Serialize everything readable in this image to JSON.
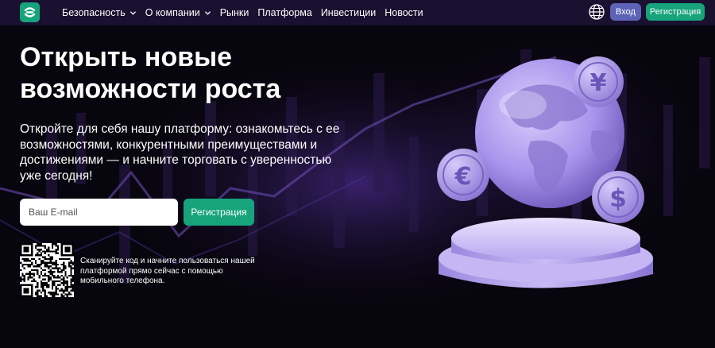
{
  "nav": {
    "items": [
      {
        "label": "Безопасность",
        "has_dropdown": true
      },
      {
        "label": "О компании",
        "has_dropdown": true
      },
      {
        "label": "Рынки",
        "has_dropdown": false
      },
      {
        "label": "Платформа",
        "has_dropdown": false
      },
      {
        "label": "Инвестиции",
        "has_dropdown": false
      },
      {
        "label": "Новости",
        "has_dropdown": false
      }
    ],
    "login_label": "Вход",
    "register_label": "Регистрация",
    "globe_icon": "globe-icon"
  },
  "hero": {
    "title": "Открыть новые возможности роста",
    "subtitle": "Откройте для себя нашу платформу: ознакомьтесь с ее возможностями, конкурентными преимуществами и достижениями — и начните торговать с уверенностью уже сегодня!",
    "email_placeholder": "Ваш E-mail",
    "register_label": "Регистрация",
    "qr_text": "Сканируйте код и начните пользоваться нашей платформой прямо сейчас с помощью мобильного телефона."
  },
  "coins": [
    "¥",
    "€",
    "$"
  ],
  "colors": {
    "nav_bg": "#1a1030",
    "page_bg": "#07050d",
    "accent_green": "#17a37b",
    "login_blue": "#5d63b6",
    "art_lavender": "#b7a6f0"
  }
}
